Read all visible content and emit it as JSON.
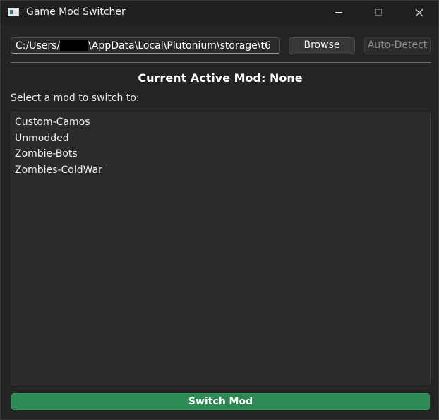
{
  "window": {
    "title": "Game Mod Switcher"
  },
  "toolbar": {
    "path_prefix": "C:/Users/",
    "path_suffix": "\\AppData\\Local\\Plutonium\\storage\\t6",
    "browse_label": "Browse",
    "autodetect_label": "Auto-Detect"
  },
  "status": {
    "active_mod_text": "Current Active Mod: None"
  },
  "mods": {
    "prompt": "Select a mod to switch to:",
    "items": [
      "Custom-Camos",
      "Unmodded",
      "Zombie-Bots",
      "Zombies-ColdWar"
    ]
  },
  "actions": {
    "switch_label": "Switch Mod"
  },
  "colors": {
    "switch_button": "#2e8a55",
    "background": "#242424"
  }
}
